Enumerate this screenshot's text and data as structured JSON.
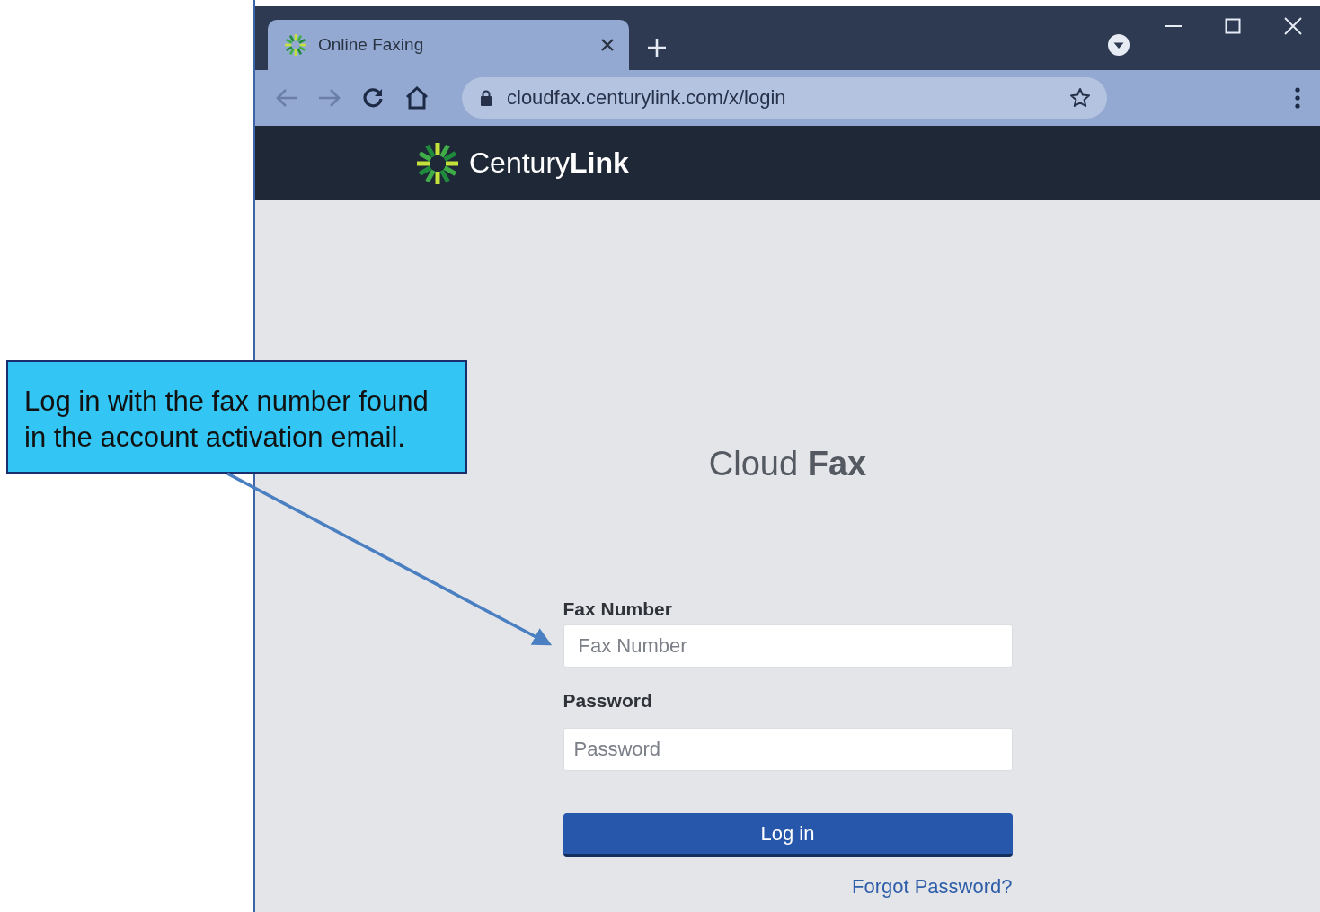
{
  "browser": {
    "tabs": [
      {
        "title": "Online Faxing",
        "selected": true
      }
    ],
    "address": "cloudfax.centurylink.com/x/login"
  },
  "site_header": {
    "logo": "Century**Link**"
  },
  "login": {
    "title": "Cloud **Fax**",
    "fields": [
      {
        "label": "Fax Number",
        "placeholder": "Fax Number",
        "kind": "text"
      },
      {
        "label": "Password",
        "placeholder": "Password",
        "kind": "password"
      }
    ],
    "button": "Log in",
    "link": "Forgot Password?"
  },
  "callout": {
    "text": "Log in with the fax number found in the account activation email."
  }
}
